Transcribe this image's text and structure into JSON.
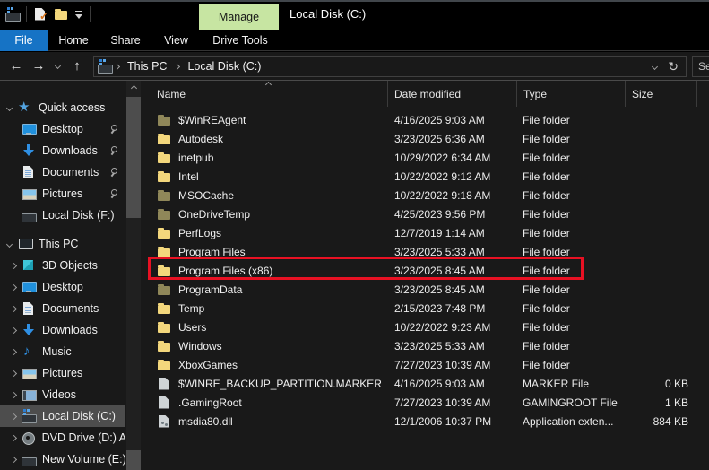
{
  "colors": {
    "accent_blue": "#1673c5",
    "manage_green": "#c7e5a2",
    "highlight_red": "#e81123",
    "selection_gray": "#4d4d4d",
    "folder_yellow": "#f3d77c",
    "background": "#191919",
    "titlebar": "#000000"
  },
  "titlebar": {
    "manage_label": "Manage",
    "title": "Local Disk (C:)",
    "qat_icons": [
      "drive-icon",
      "properties-check-icon",
      "new-folder-icon",
      "customize-toolbar-icon"
    ]
  },
  "ribbon": {
    "tabs": [
      {
        "label": "File",
        "active": true
      },
      {
        "label": "Home",
        "active": false
      },
      {
        "label": "Share",
        "active": false
      },
      {
        "label": "View",
        "active": false
      },
      {
        "label": "Drive Tools",
        "active": false,
        "contextual": true
      }
    ]
  },
  "address_bar": {
    "nav": {
      "back": "←",
      "forward": "→",
      "up": "↑",
      "refresh": "↻"
    },
    "breadcrumb": [
      "This PC",
      "Local Disk (C:)"
    ],
    "search_text": "Se"
  },
  "sidebar": {
    "sections": [
      {
        "label": "Quick access",
        "icon": "star",
        "items": [
          {
            "label": "Desktop",
            "icon": "desktop",
            "pinned": true,
            "chevron": false
          },
          {
            "label": "Downloads",
            "icon": "download",
            "pinned": true,
            "chevron": false
          },
          {
            "label": "Documents",
            "icon": "document",
            "pinned": true,
            "chevron": false
          },
          {
            "label": "Pictures",
            "icon": "picture",
            "pinned": true,
            "chevron": false
          },
          {
            "label": "Local Disk (F:)",
            "icon": "drive",
            "pinned": false,
            "chevron": false
          }
        ]
      },
      {
        "label": "This PC",
        "icon": "computer",
        "items": [
          {
            "label": "3D Objects",
            "icon": "cube",
            "pinned": false,
            "chevron": true
          },
          {
            "label": "Desktop",
            "icon": "desktop",
            "pinned": false,
            "chevron": true
          },
          {
            "label": "Documents",
            "icon": "document",
            "pinned": false,
            "chevron": true
          },
          {
            "label": "Downloads",
            "icon": "download",
            "pinned": false,
            "chevron": true
          },
          {
            "label": "Music",
            "icon": "music",
            "pinned": false,
            "chevron": true
          },
          {
            "label": "Pictures",
            "icon": "picture",
            "pinned": false,
            "chevron": true
          },
          {
            "label": "Videos",
            "icon": "video",
            "pinned": false,
            "chevron": true
          },
          {
            "label": "Local Disk (C:)",
            "icon": "drive-os",
            "pinned": false,
            "chevron": true,
            "selected": true
          },
          {
            "label": "DVD Drive (D:) AU",
            "icon": "disc",
            "pinned": false,
            "chevron": true
          },
          {
            "label": "New Volume (E:)",
            "icon": "drive",
            "pinned": false,
            "chevron": true
          }
        ]
      }
    ]
  },
  "file_list": {
    "columns": [
      "Name",
      "Date modified",
      "Type",
      "Size"
    ],
    "sort_column": "Name",
    "sort_ascending": true,
    "rows": [
      {
        "name": "$WinREAgent",
        "date": "4/16/2025 9:03 AM",
        "type": "File folder",
        "size": "",
        "icon": "folder",
        "faded": true
      },
      {
        "name": "Autodesk",
        "date": "3/23/2025 6:36 AM",
        "type": "File folder",
        "size": "",
        "icon": "folder",
        "faded": false
      },
      {
        "name": "inetpub",
        "date": "10/29/2022 6:34 AM",
        "type": "File folder",
        "size": "",
        "icon": "folder",
        "faded": false
      },
      {
        "name": "Intel",
        "date": "10/22/2022 9:12 AM",
        "type": "File folder",
        "size": "",
        "icon": "folder",
        "faded": false
      },
      {
        "name": "MSOCache",
        "date": "10/22/2022 9:18 AM",
        "type": "File folder",
        "size": "",
        "icon": "folder",
        "faded": true
      },
      {
        "name": "OneDriveTemp",
        "date": "4/25/2023 9:56 PM",
        "type": "File folder",
        "size": "",
        "icon": "folder",
        "faded": true
      },
      {
        "name": "PerfLogs",
        "date": "12/7/2019 1:14 AM",
        "type": "File folder",
        "size": "",
        "icon": "folder",
        "faded": false
      },
      {
        "name": "Program Files",
        "date": "3/23/2025 5:33 AM",
        "type": "File folder",
        "size": "",
        "icon": "folder",
        "faded": false
      },
      {
        "name": "Program Files (x86)",
        "date": "3/23/2025 8:45 AM",
        "type": "File folder",
        "size": "",
        "icon": "folder",
        "faded": false,
        "highlighted": true
      },
      {
        "name": "ProgramData",
        "date": "3/23/2025 8:45 AM",
        "type": "File folder",
        "size": "",
        "icon": "folder",
        "faded": true
      },
      {
        "name": "Temp",
        "date": "2/15/2023 7:48 PM",
        "type": "File folder",
        "size": "",
        "icon": "folder",
        "faded": false
      },
      {
        "name": "Users",
        "date": "10/22/2022 9:23 AM",
        "type": "File folder",
        "size": "",
        "icon": "folder",
        "faded": false
      },
      {
        "name": "Windows",
        "date": "3/23/2025 5:33 AM",
        "type": "File folder",
        "size": "",
        "icon": "folder",
        "faded": false
      },
      {
        "name": "XboxGames",
        "date": "7/27/2023 10:39 AM",
        "type": "File folder",
        "size": "",
        "icon": "folder",
        "faded": false
      },
      {
        "name": "$WINRE_BACKUP_PARTITION.MARKER",
        "date": "4/16/2025 9:03 AM",
        "type": "MARKER File",
        "size": "0 KB",
        "icon": "file",
        "faded": false
      },
      {
        "name": ".GamingRoot",
        "date": "7/27/2023 10:39 AM",
        "type": "GAMINGROOT File",
        "size": "1 KB",
        "icon": "file",
        "faded": false
      },
      {
        "name": "msdia80.dll",
        "date": "12/1/2006 10:37 PM",
        "type": "Application exten...",
        "size": "884 KB",
        "icon": "dll",
        "faded": false
      }
    ]
  },
  "annotation": {
    "highlighted_row": "Program Files (x86)"
  }
}
